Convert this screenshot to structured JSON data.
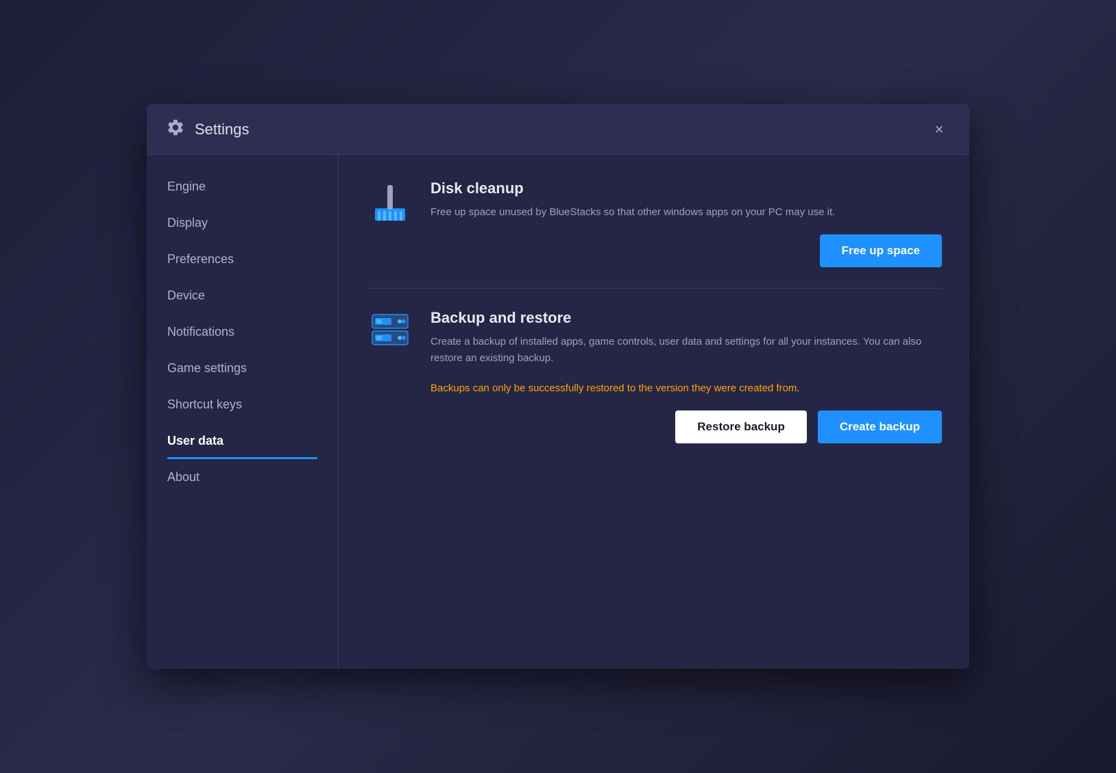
{
  "header": {
    "title": "Settings",
    "close_label": "×"
  },
  "sidebar": {
    "items": [
      {
        "id": "engine",
        "label": "Engine",
        "active": false
      },
      {
        "id": "display",
        "label": "Display",
        "active": false
      },
      {
        "id": "preferences",
        "label": "Preferences",
        "active": false
      },
      {
        "id": "device",
        "label": "Device",
        "active": false
      },
      {
        "id": "notifications",
        "label": "Notifications",
        "active": false
      },
      {
        "id": "game-settings",
        "label": "Game settings",
        "active": false
      },
      {
        "id": "shortcut-keys",
        "label": "Shortcut keys",
        "active": false
      },
      {
        "id": "user-data",
        "label": "User data",
        "active": true
      },
      {
        "id": "about",
        "label": "About",
        "active": false
      }
    ]
  },
  "main": {
    "disk_cleanup": {
      "title": "Disk cleanup",
      "description": "Free up space unused by BlueStacks so that other windows apps on your PC may use it.",
      "button_label": "Free up space"
    },
    "backup_restore": {
      "title": "Backup and restore",
      "description": "Create a backup of installed apps, game controls, user data and settings for all your instances. You can also restore an existing backup.",
      "warning": "Backups can only be successfully restored to the version they were created from.",
      "restore_label": "Restore backup",
      "create_label": "Create backup"
    }
  }
}
